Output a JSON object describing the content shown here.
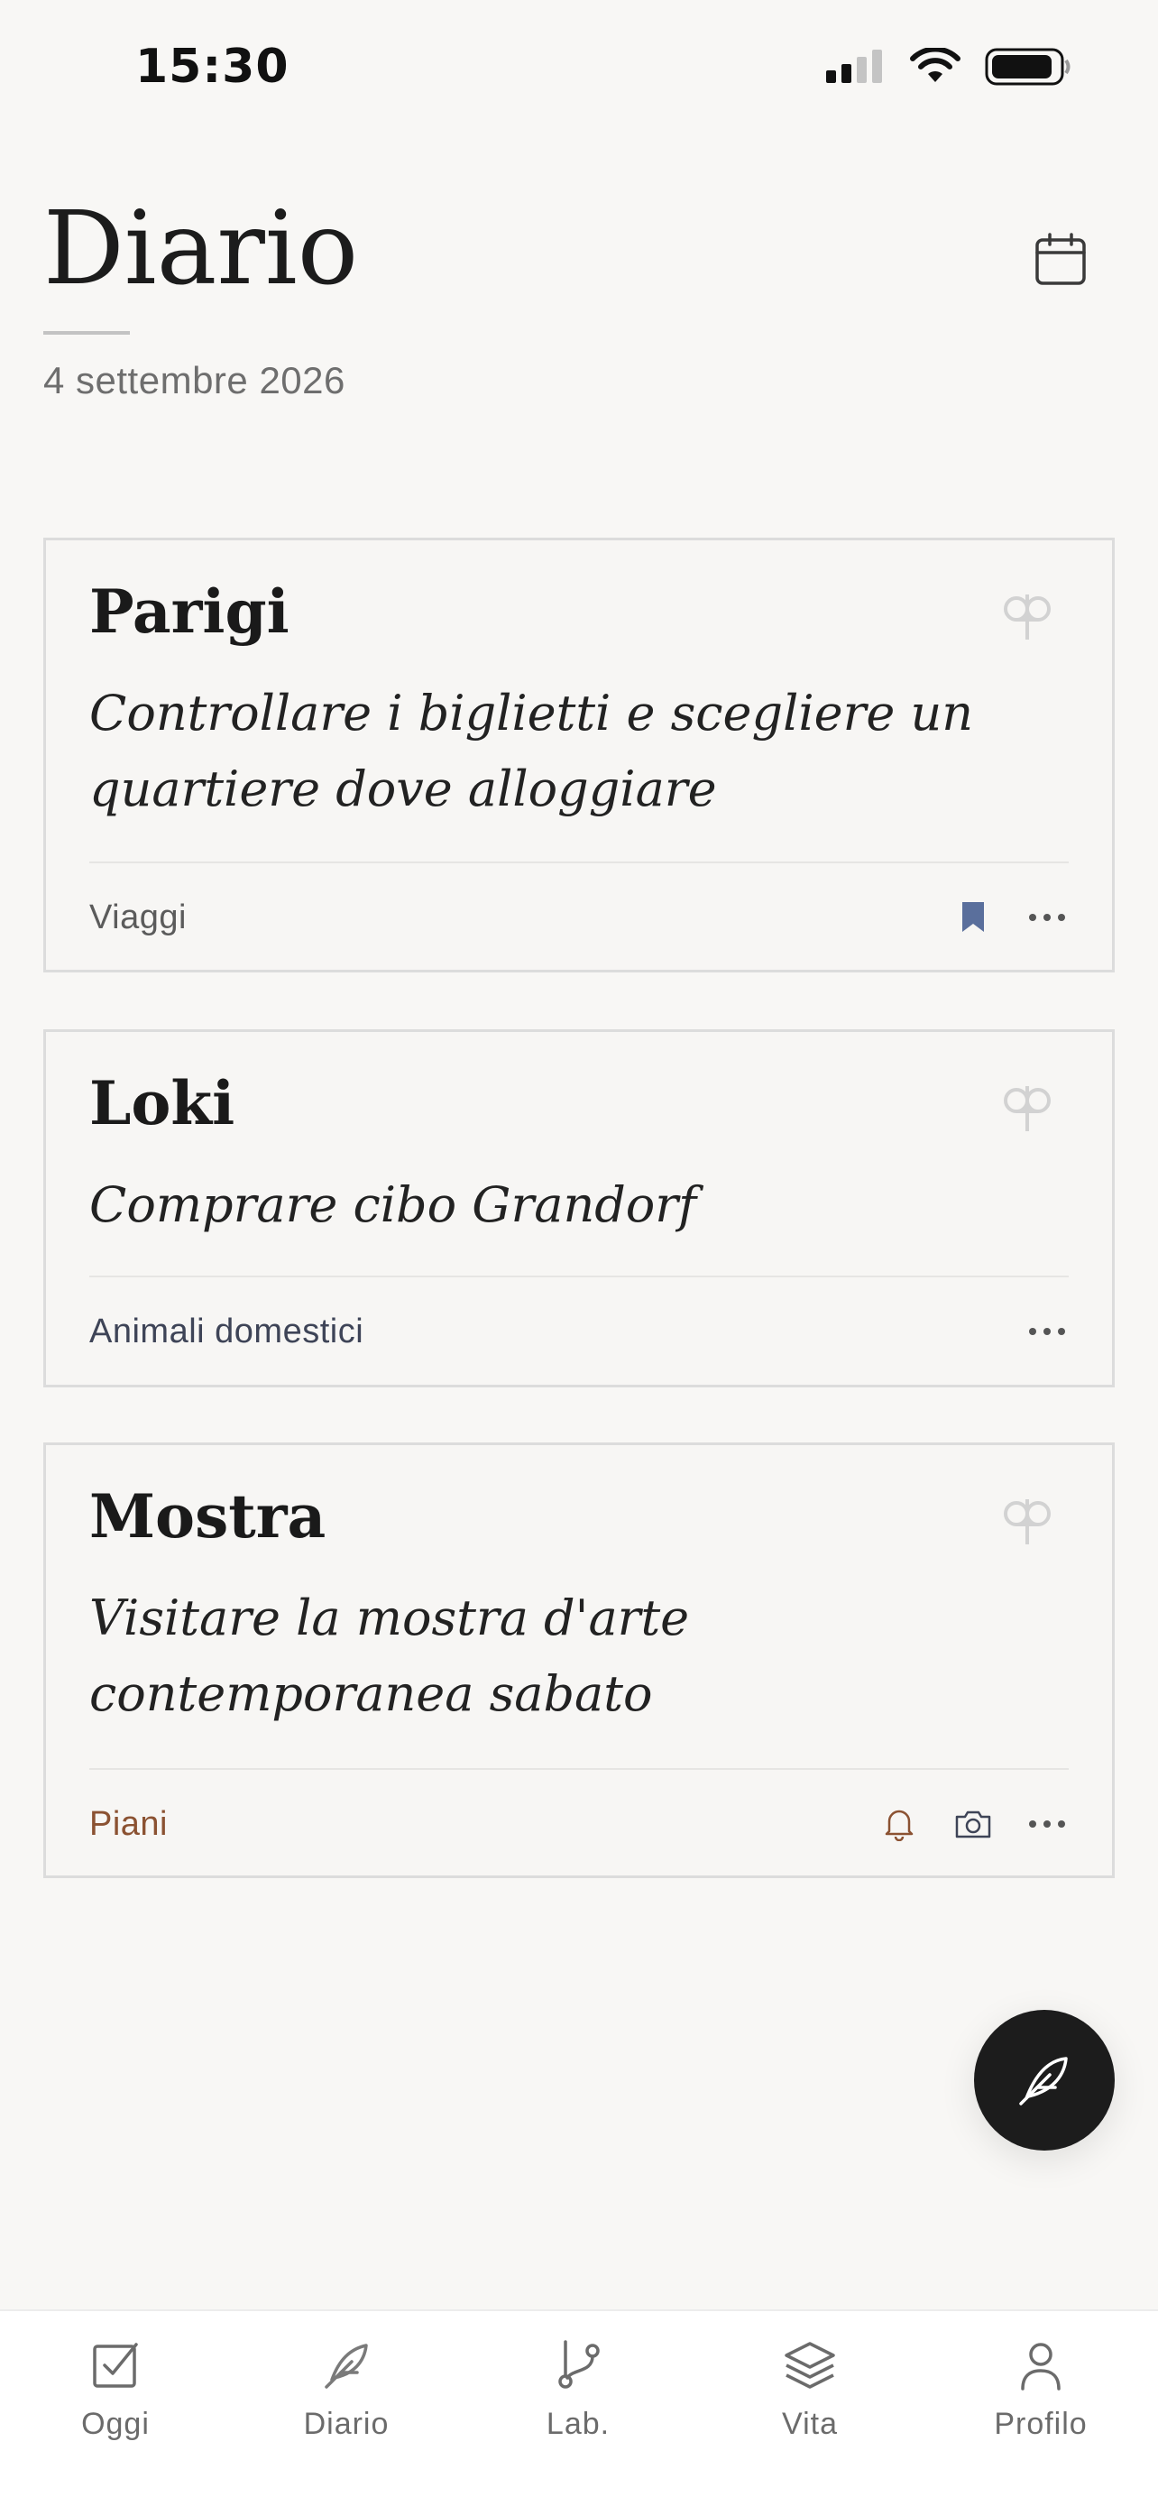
{
  "status": {
    "time": "15:30"
  },
  "header": {
    "title": "Diario",
    "date": "4 settembre 2026"
  },
  "entries": [
    {
      "title": "Parigi",
      "body": "Controllare i biglietti e scegliere un quartiere dove alloggiare",
      "category": "Viaggi",
      "bookmarked": true,
      "bookmark_color": "#5a6f9c"
    },
    {
      "title": "Loki",
      "body": "Comprare cibo Grandorf",
      "category": "Animali domestici"
    },
    {
      "title": "Mostra",
      "body": "Visitare la mostra d'arte contemporanea sabato",
      "category": "Piani",
      "category_color": "#8b5232",
      "has_reminder": true,
      "has_photo": true
    }
  ],
  "tabs": [
    {
      "label": "Oggi",
      "icon": "checkbox-icon"
    },
    {
      "label": "Diario",
      "icon": "feather-icon",
      "active": true
    },
    {
      "label": "Lab.",
      "icon": "branch-icon"
    },
    {
      "label": "Vita",
      "icon": "layers-icon"
    },
    {
      "label": "Profilo",
      "icon": "person-icon"
    }
  ],
  "colors": {
    "background": "#f8f7f5",
    "fab": "#1c1c1c",
    "accent_bookmark": "#5a6f9c"
  }
}
